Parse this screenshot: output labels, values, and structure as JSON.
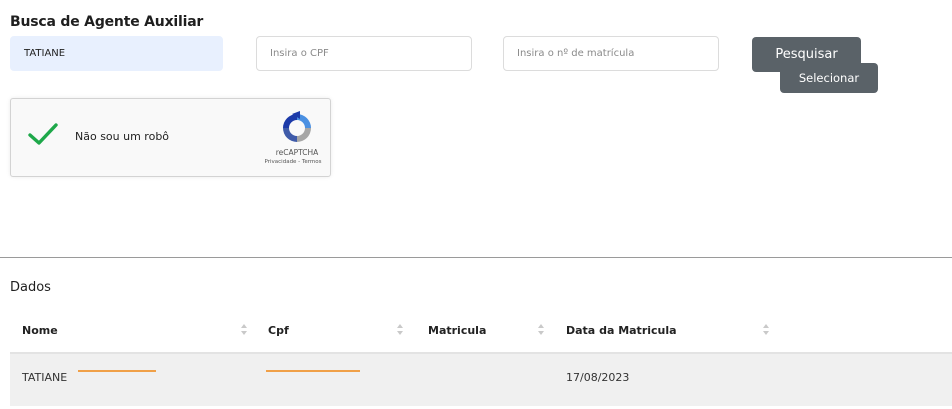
{
  "search": {
    "title": "Busca de Agente Auxiliar",
    "name_value": "TATIANE",
    "cpf_placeholder": "Insira o CPF",
    "matricula_placeholder": "Insira o nº de matrícula",
    "search_button": "Pesquisar"
  },
  "captcha": {
    "label": "Não sou um robô",
    "brand": "reCAPTCHA",
    "privacy": "Privacidade - Termos",
    "checked": true,
    "check_color": "#1ea84a"
  },
  "data": {
    "title": "Dados",
    "columns": [
      "Nome",
      "Cpf",
      "Matricula",
      "Data da Matricula",
      ""
    ],
    "rows": [
      {
        "nome": "TATIANE",
        "cpf": "",
        "matricula": "",
        "data": "17/08/2023",
        "action": "Selecionar"
      }
    ]
  },
  "colors": {
    "button": "#5a6268",
    "filled_input": "#e8f0fe",
    "row_bg": "#f0f0f0",
    "redaction": "#f0a048"
  }
}
